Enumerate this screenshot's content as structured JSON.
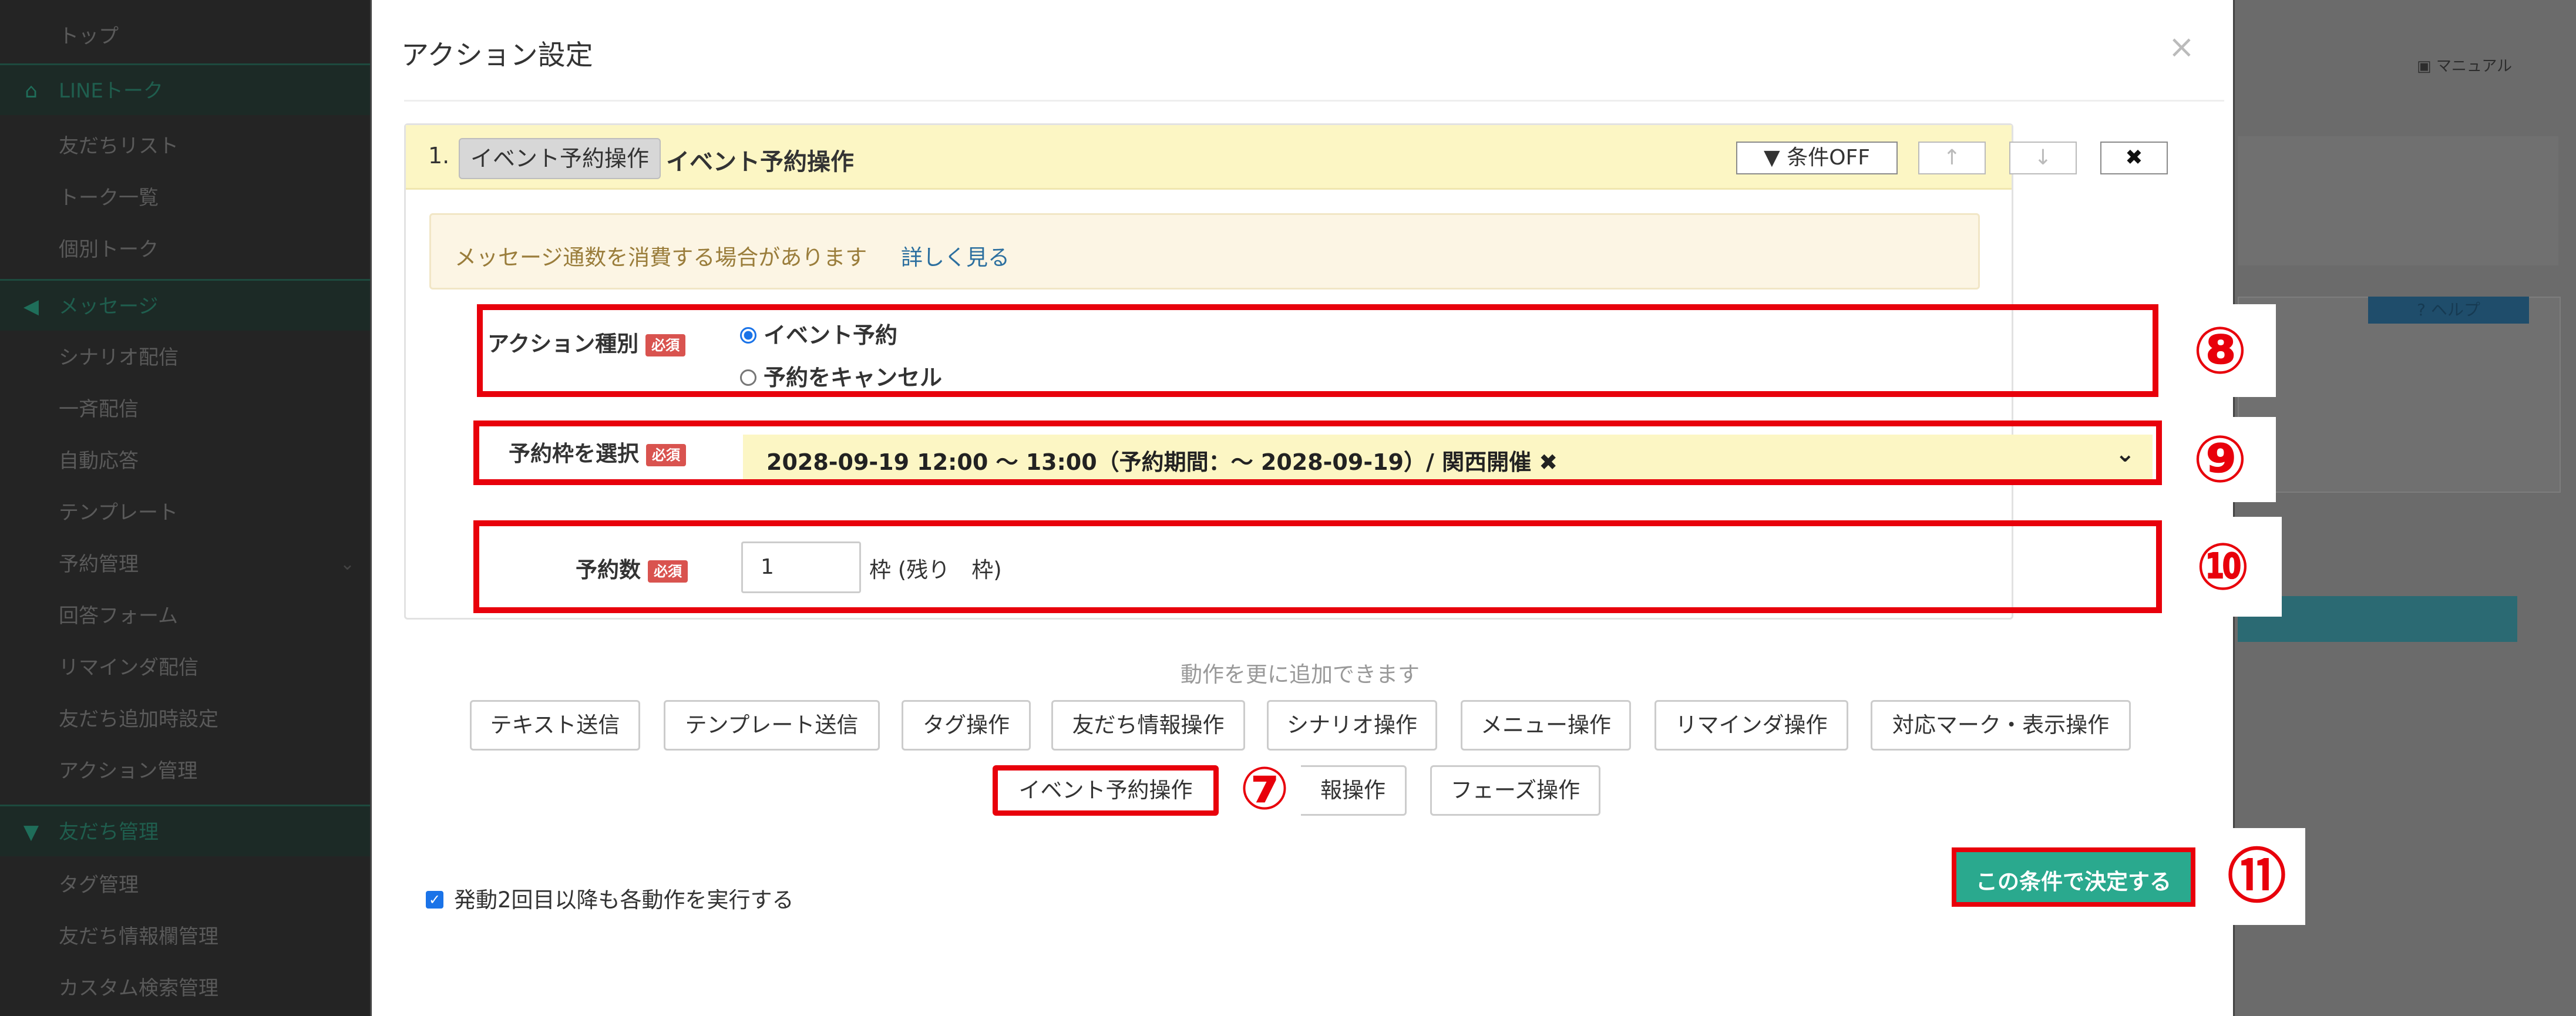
{
  "sidebar": {
    "sections": [
      {
        "label": "LINEトーク",
        "icon": "home-icon"
      },
      {
        "label": "メッセージ",
        "icon": "megaphone-icon"
      },
      {
        "label": "友だち管理",
        "icon": "filter-icon"
      }
    ],
    "items_line": [
      "友だちリスト",
      "トーク一覧",
      "個別トーク"
    ],
    "items_msg": [
      "シナリオ配信",
      "一斉配信",
      "自動応答",
      "テンプレート",
      "予約管理",
      "回答フォーム",
      "リマインダ配信",
      "友だち追加時設定",
      "アクション管理"
    ],
    "items_friends": [
      "タグ管理",
      "友だち情報欄管理",
      "カスタム検索管理"
    ],
    "top_item": "トップ"
  },
  "background": {
    "manual": "マニュアル",
    "help": "ヘルプ"
  },
  "modal": {
    "title": "アクション設定",
    "close": "×",
    "action": {
      "number": "1.",
      "type_pill": "イベント予約操作",
      "title": "イベント予約操作",
      "btn_condition": "条件OFF",
      "btn_up": "↑",
      "btn_down": "↓",
      "btn_delete": "✖"
    },
    "notice": {
      "text": "メッセージ通数を消費する場合があります",
      "link": "詳しく見る"
    },
    "required_badge": "必須",
    "action_type": {
      "label": "アクション種別",
      "options": [
        "イベント予約",
        "予約をキャンセル"
      ],
      "selected": "イベント予約"
    },
    "slot": {
      "label": "予約枠を選択",
      "value": "2028-09-19 12:00 〜 13:00（予約期間：〜 2028-09-19）/ 関西開催 ✖",
      "chevron": "⌄"
    },
    "count": {
      "label": "予約数",
      "value": "1",
      "suffix": "枠 (残り　枠)"
    },
    "add_hint": "動作を更に追加できます",
    "ops_row1": [
      "テキスト送信",
      "テンプレート送信",
      "タグ操作",
      "友だち情報操作",
      "シナリオ操作",
      "メニュー操作",
      "リマインダ操作",
      "対応マーク・表示操作"
    ],
    "ops_row2": [
      "イベント予約操作",
      "報操作",
      "フェーズ操作"
    ],
    "repeat_checkbox": "発動2回目以降も各動作を実行する",
    "submit": "この条件で決定する"
  },
  "callouts": {
    "c7": "⑦",
    "c8": "⑧",
    "c9": "⑨",
    "c10": "⑩",
    "c11": "⑪"
  },
  "colors": {
    "highlight_red": "#e8000b",
    "submit_green": "#2aa98e",
    "header_yellow": "#fcf6c4",
    "required_red": "#d9534f"
  }
}
